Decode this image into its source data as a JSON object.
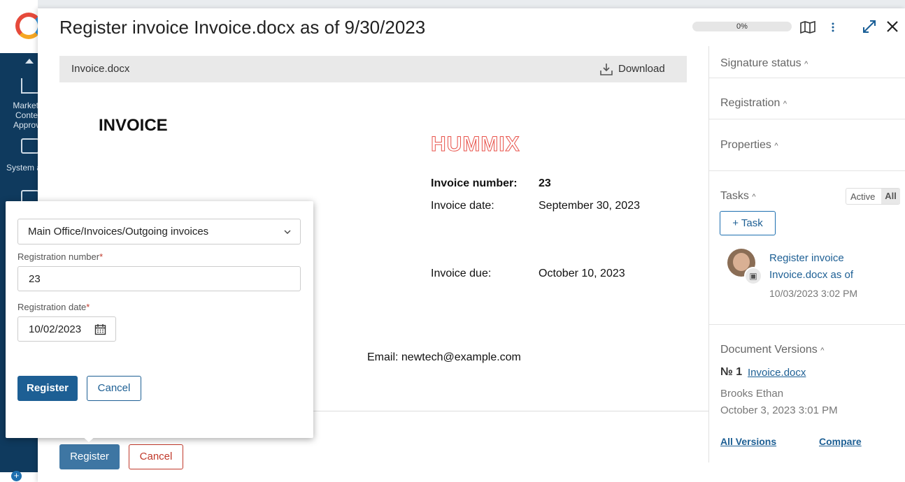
{
  "window": {
    "title": "Register invoice Invoice.docx as of 9/30/2023",
    "progress": "0%"
  },
  "app_nav": {
    "items": [
      {
        "label_lines": [
          "Marketi",
          "Conte",
          "Approv"
        ]
      },
      {
        "label_lines": [
          "System a"
        ]
      }
    ]
  },
  "viewer": {
    "file_name": "Invoice.docx",
    "download_label": "Download"
  },
  "document": {
    "heading": "INVOICE",
    "company_logo": "HUMMIX",
    "invoice_number_label": "Invoice number:",
    "invoice_number_value": "23",
    "invoice_date_label": "Invoice date:",
    "invoice_date_value": "September 30, 2023",
    "invoice_due_label": "Invoice due:",
    "invoice_due_value": "October 10, 2023",
    "email_line": "Email: newtech@example.com"
  },
  "footer": {
    "register_label": "Register",
    "cancel_label": "Cancel"
  },
  "sidebar": {
    "signature_status": "Signature status",
    "registration": "Registration",
    "properties": "Properties",
    "tasks": {
      "title": "Tasks",
      "filter_active": "Active",
      "filter_all": "All",
      "add_task_label": "+ Task",
      "items": [
        {
          "title_line1": "Register invoice",
          "title_line2": "Invoice.docx as of",
          "timestamp": "10/03/2023 3:02 PM"
        }
      ]
    },
    "versions": {
      "title": "Document Versions",
      "number": "№ 1",
      "file_link": "Invoice.docx",
      "author": "Brooks Ethan",
      "date": "October 3, 2023 3:01 PM",
      "all_versions": "All Versions",
      "compare": "Compare"
    }
  },
  "register_popup": {
    "folder_select": "Main Office/Invoices/Outgoing invoices",
    "reg_number_label": "Registration number",
    "reg_number_value": "23",
    "reg_date_label": "Registration date",
    "reg_date_value": "10/02/2023",
    "required_mark": "*",
    "register_label": "Register",
    "cancel_label": "Cancel"
  },
  "colors": {
    "primary": "#1d5f94",
    "danger": "#c0392b",
    "nav_bg": "#0f3a5e",
    "logo_red": "#e8524a"
  },
  "icons": [
    "map-icon",
    "more-vertical-icon",
    "expand-icon",
    "close-icon",
    "download-icon",
    "chevron-up-icon",
    "chevron-down-icon",
    "calendar-icon",
    "task-badge-icon"
  ]
}
